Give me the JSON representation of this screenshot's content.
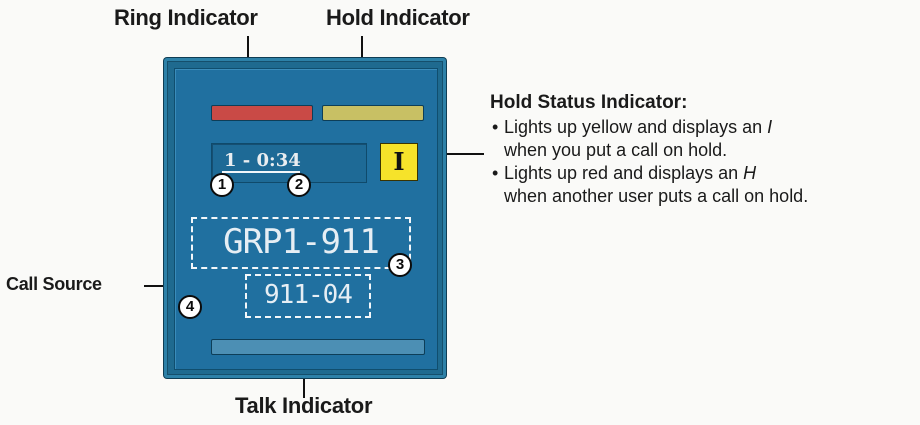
{
  "callouts": {
    "ring_indicator": "Ring Indicator",
    "hold_indicator": "Hold Indicator",
    "talk_indicator": "Talk Indicator",
    "call_source": "Call Source"
  },
  "panel": {
    "lcd_line": "1 - 0:34",
    "hold_status_glyph": "I",
    "group_name": "GRP1-911",
    "call_source_id": "911-04",
    "badges": [
      "1",
      "2",
      "3",
      "4"
    ],
    "colors": {
      "ring_lamp": "#c94a46",
      "hold_lamp": "#c8c064",
      "hold_status": "#f6e32a",
      "panel": "#1f6a8f"
    }
  },
  "hold_status_info": {
    "title": "Hold Status Indicator:",
    "bullet1_before": "Lights up yellow and displays an ",
    "bullet1_glyph": "I",
    "bullet1_line2": "when you put a call on hold.",
    "bullet2_before": "Lights up red and displays an ",
    "bullet2_glyph": "H",
    "bullet2_line2": "when another user puts a call on hold."
  }
}
